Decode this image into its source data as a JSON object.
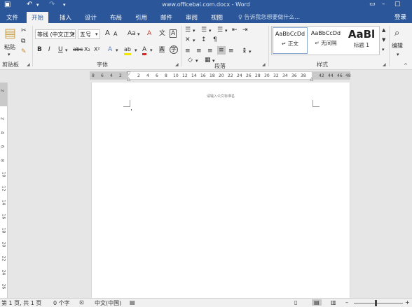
{
  "window": {
    "title": "www.officebai.com.docx - Word",
    "save_icon": "save-icon",
    "undo_icon": "undo-icon",
    "redo_icon": "redo-icon",
    "options_icon": "ribbon-options-icon",
    "accent_color": "#2b579a"
  },
  "tabs": [
    {
      "label": "文件"
    },
    {
      "label": "开始"
    },
    {
      "label": "插入"
    },
    {
      "label": "设计"
    },
    {
      "label": "布局"
    },
    {
      "label": "引用"
    },
    {
      "label": "邮件"
    },
    {
      "label": "审阅"
    },
    {
      "label": "视图"
    }
  ],
  "active_tab": "开始",
  "tell_me": "告诉我您想要做什么...",
  "login": "登录",
  "ribbon": {
    "clipboard": {
      "paste_label": "粘贴",
      "group_label": "剪贴板"
    },
    "font": {
      "font_name": "等线 (中文正文)",
      "font_size": "五号",
      "grow": "A",
      "shrink": "A",
      "case": "Aa",
      "clear_format": "A",
      "phonetic": "文",
      "border_char": "A",
      "bold": "B",
      "italic": "I",
      "underline": "U",
      "strike": "abc",
      "subscript": "X₂",
      "superscript": "X²",
      "text_effect": "A",
      "highlight": "ab",
      "font_color": "A",
      "shading": "A",
      "enclose": "字",
      "group_label": "字体"
    },
    "paragraph": {
      "group_label": "段落"
    },
    "styles": {
      "items": [
        {
          "sample": "AaBbCcDd",
          "name": "↵ 正文"
        },
        {
          "sample": "AaBbCcDd",
          "name": "↵ 无间隔"
        },
        {
          "sample": "AaBl",
          "name": "标题 1"
        }
      ],
      "group_label": "样式"
    },
    "editing": {
      "label": "编辑"
    }
  },
  "ruler": {
    "h_labels": [
      "8",
      "6",
      "4",
      "2",
      "2",
      "4",
      "6",
      "8",
      "10",
      "12",
      "14",
      "16",
      "18",
      "20",
      "22",
      "24",
      "26",
      "28",
      "30",
      "32",
      "34",
      "36",
      "38",
      "42",
      "44",
      "46",
      "48"
    ],
    "v_labels": [
      "2",
      "2",
      "4",
      "6",
      "8",
      "10",
      "12",
      "14",
      "16",
      "18",
      "20",
      "22",
      "24",
      "26"
    ]
  },
  "page": {
    "header_text": "请输入公文标准名"
  },
  "status": {
    "page_info": "第 1 页, 共 1 页",
    "word_count": "0 个字",
    "language": "中文(中国)"
  }
}
